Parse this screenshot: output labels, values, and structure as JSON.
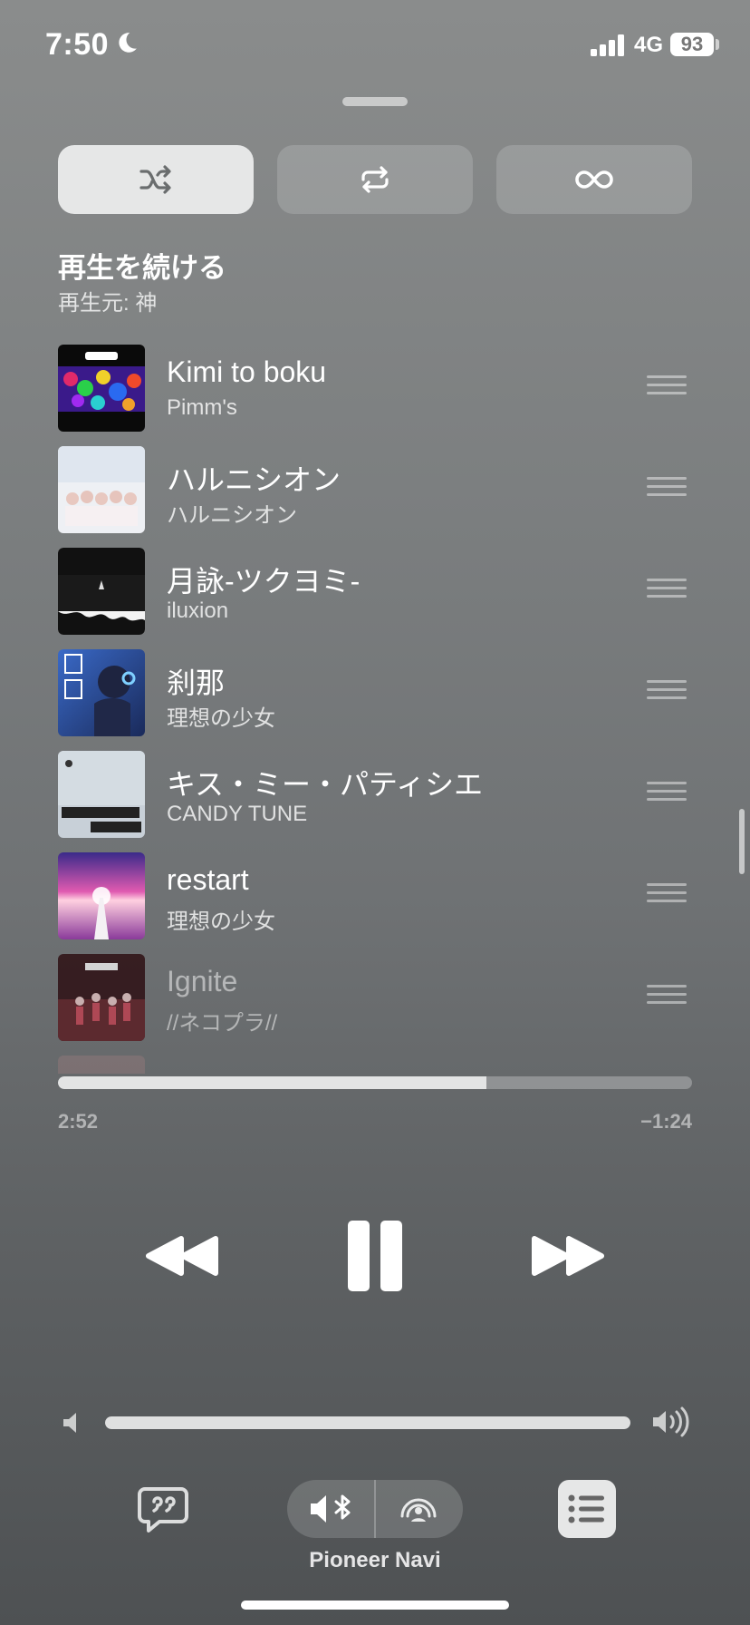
{
  "status_bar": {
    "time": "7:50",
    "network": "4G",
    "battery": "93"
  },
  "modes": [
    {
      "name": "shuffle",
      "icon": "shuffle-icon",
      "active": true
    },
    {
      "name": "repeat",
      "icon": "repeat-icon",
      "active": false
    },
    {
      "name": "autoplay",
      "icon": "infinity-icon",
      "active": false
    }
  ],
  "section": {
    "title": "再生を続ける",
    "subtitle": "再生元: 神"
  },
  "queue": [
    {
      "title": "Kimi to boku",
      "artist": "Pimm's"
    },
    {
      "title": "ハルニシオン",
      "artist": "ハルニシオン"
    },
    {
      "title": "月詠-ツクヨミ-",
      "artist": "iluxion"
    },
    {
      "title": "刹那",
      "artist": "理想の少女"
    },
    {
      "title": "キス・ミー・パティシエ",
      "artist": "CANDY TUNE"
    },
    {
      "title": "restart",
      "artist": "理想の少女"
    },
    {
      "title": "Ignite",
      "artist": "//ネコプラ//"
    }
  ],
  "playback": {
    "elapsed": "2:52",
    "remaining": "−1:24",
    "progress_fraction": 0.675,
    "volume_fraction": 1.0
  },
  "output": {
    "device": "Pioneer Navi"
  },
  "colors": {
    "active_button": "#e6e7e7",
    "background_top": "#8a8c8c",
    "background_bottom": "#4e5153"
  }
}
